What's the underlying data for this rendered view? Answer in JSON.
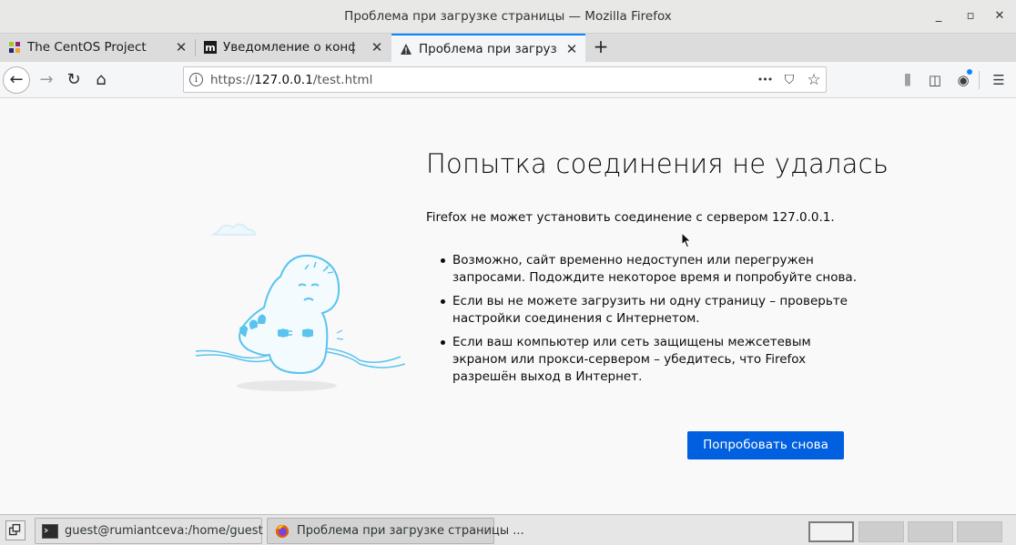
{
  "window": {
    "title": "Проблема при загрузке страницы — Mozilla Firefox",
    "minimize": "_",
    "maximize": "▫",
    "close": "✕"
  },
  "tabs": [
    {
      "label": "The CentOS Project",
      "close": "✕"
    },
    {
      "label": "Уведомление о конфиде",
      "close": "✕"
    },
    {
      "label": "Проблема при загрузке с",
      "close": "✕"
    }
  ],
  "new_tab": "+",
  "nav": {
    "back": "←",
    "forward": "→",
    "reload": "↻",
    "home": "⌂",
    "url_scheme": "https://",
    "url_host": "127.0.0.1",
    "url_path": "/test.html",
    "page_actions": "•••",
    "pocket": "⛉",
    "bookmark": "☆",
    "library": "⫼",
    "sidebar": "◫",
    "account": "◉",
    "menu": "☰"
  },
  "error": {
    "title": "Попытка соединения не удалась",
    "description": "Firefox не может установить соединение с сервером 127.0.0.1.",
    "bullets": [
      "Возможно, сайт временно недоступен или перегружен запросами. Подождите некоторое время и попробуйте снова.",
      "Если вы не можете загрузить ни одну страницу – проверьте настройки соединения с Интернетом.",
      "Если ваш компьютер или сеть защищены межсетевым экраном или прокси-сервером – убедитесь, что Firefox разрешён выход в Интернет."
    ],
    "retry_button": "Попробовать снова"
  },
  "taskbar": {
    "tasks": [
      {
        "label": "guest@rumiantceva:/home/guest",
        "icon": "terminal-icon"
      },
      {
        "label": "Проблема при загрузке страницы ...",
        "icon": "firefox-icon"
      }
    ],
    "workspaces": 4,
    "active_workspace": 1
  },
  "colors": {
    "accent": "#0a84ff",
    "button": "#0060df",
    "illustration": "#5ac4ee"
  }
}
